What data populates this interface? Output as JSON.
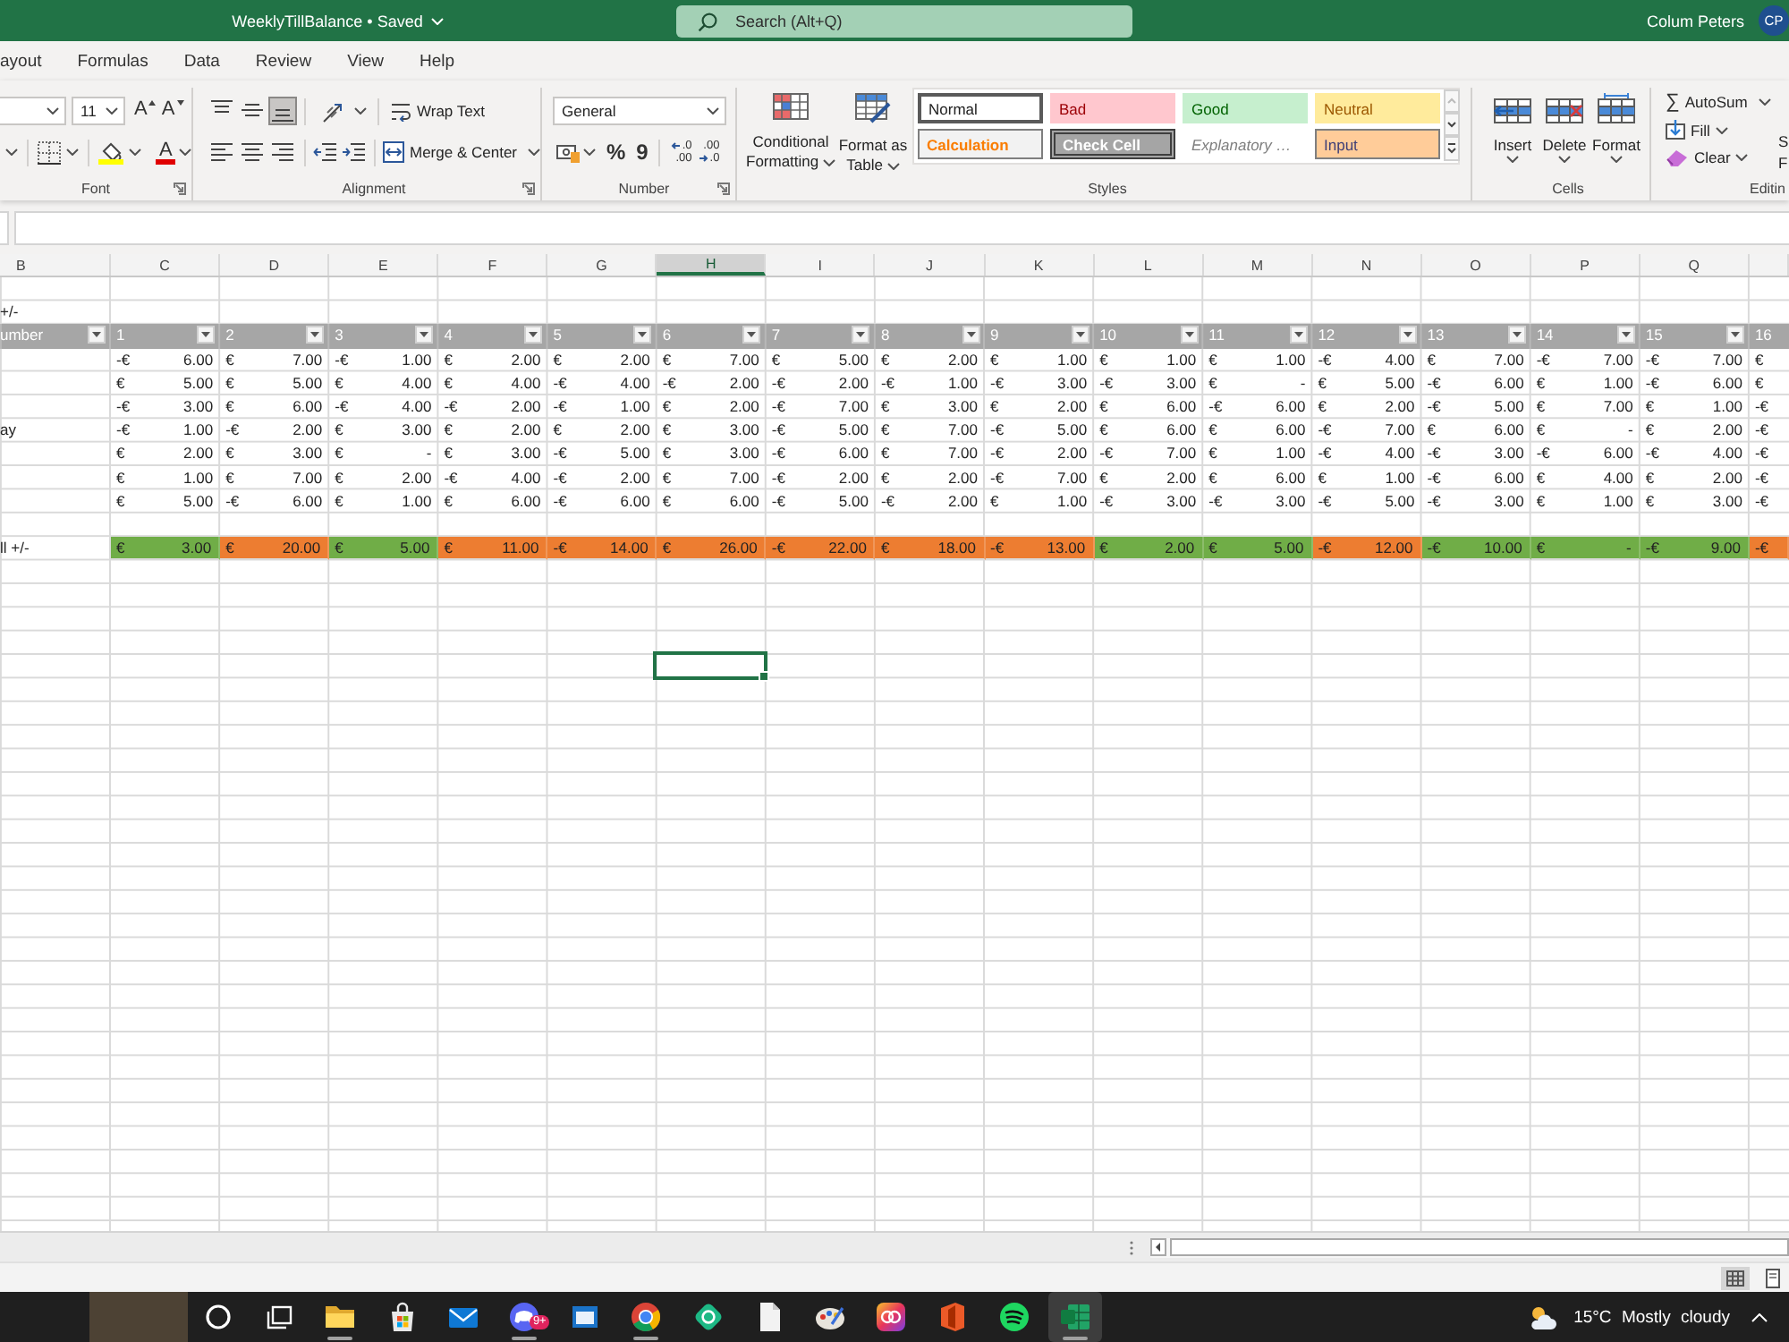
{
  "title_bar": {
    "title": "WeeklyTillBalance • Saved",
    "search_placeholder": "Search (Alt+Q)",
    "user_name": "Colum Peters",
    "avatar_initials": "CP"
  },
  "menu_tabs": [
    {
      "label": "ayout"
    },
    {
      "label": "Formulas"
    },
    {
      "label": "Data"
    },
    {
      "label": "Review"
    },
    {
      "label": "View"
    },
    {
      "label": "Help"
    }
  ],
  "ribbon": {
    "font": {
      "size": "11",
      "grow_glyph": "A",
      "shrink_glyph": "A",
      "color_glyph": "A",
      "label": "Font"
    },
    "alignment": {
      "vertical_align": [
        {
          "kind": "top",
          "selected": false
        },
        {
          "kind": "middle",
          "selected": false
        },
        {
          "kind": "bottom",
          "selected": true
        }
      ],
      "wrap_text": "Wrap Text",
      "merge": "Merge & Center",
      "label": "Alignment"
    },
    "number": {
      "format": "General",
      "percent_glyph": "%",
      "comma_glyph": "9",
      "increase_decimal": [
        ".0",
        ".00"
      ],
      "decrease_decimal": [
        ".00",
        ".0"
      ],
      "label": "Number"
    },
    "styles": {
      "conditional_formatting": [
        "Conditional",
        "Formatting"
      ],
      "format_as_table": [
        "Format as",
        "Table"
      ],
      "cell_styles": [
        {
          "label": "Normal",
          "kind": "normal",
          "selected": true
        },
        {
          "label": "Bad",
          "kind": "bad",
          "selected": false
        },
        {
          "label": "Good",
          "kind": "good",
          "selected": false
        },
        {
          "label": "Neutral",
          "kind": "neutral",
          "selected": false
        },
        {
          "label": "Calculation",
          "kind": "calculation",
          "selected": false
        },
        {
          "label": "Check Cell",
          "kind": "check",
          "selected": false
        },
        {
          "label": "Explanatory …",
          "kind": "explanatory",
          "selected": false
        },
        {
          "label": "Input",
          "kind": "input",
          "selected": false
        }
      ],
      "label": "Styles"
    },
    "cells": {
      "buttons": [
        {
          "kind": "insert",
          "label": "Insert"
        },
        {
          "kind": "delete",
          "label": "Delete"
        },
        {
          "kind": "format",
          "label": "Format"
        }
      ],
      "label": "Cells"
    },
    "editing": {
      "autosum_glyph": "∑",
      "autosum": "AutoSum",
      "fill": "Fill",
      "clear": "Clear",
      "cut_button": [
        "S",
        "F"
      ],
      "label": "Editin"
    }
  },
  "sheet": {
    "columns": [
      {
        "letter": "B",
        "selected": false
      },
      {
        "letter": "C",
        "selected": false
      },
      {
        "letter": "D",
        "selected": false
      },
      {
        "letter": "E",
        "selected": false
      },
      {
        "letter": "F",
        "selected": false
      },
      {
        "letter": "G",
        "selected": false
      },
      {
        "letter": "H",
        "selected": true
      },
      {
        "letter": "I",
        "selected": false
      },
      {
        "letter": "J",
        "selected": false
      },
      {
        "letter": "K",
        "selected": false
      },
      {
        "letter": "L",
        "selected": false
      },
      {
        "letter": "M",
        "selected": false
      },
      {
        "letter": "N",
        "selected": false
      },
      {
        "letter": "O",
        "selected": false
      },
      {
        "letter": "P",
        "selected": false
      },
      {
        "letter": "Q",
        "selected": false
      }
    ],
    "title_row": "+/-",
    "headers": [
      {
        "label": "umber",
        "filter": true
      },
      {
        "label": "1",
        "filter": true
      },
      {
        "label": "2",
        "filter": true
      },
      {
        "label": "3",
        "filter": true
      },
      {
        "label": "4",
        "filter": true
      },
      {
        "label": "5",
        "filter": true
      },
      {
        "label": "6",
        "filter": true
      },
      {
        "label": "7",
        "filter": true
      },
      {
        "label": "8",
        "filter": true
      },
      {
        "label": "9",
        "filter": true
      },
      {
        "label": "10",
        "filter": true
      },
      {
        "label": "11",
        "filter": true
      },
      {
        "label": "12",
        "filter": true
      },
      {
        "label": "13",
        "filter": true
      },
      {
        "label": "14",
        "filter": true
      },
      {
        "label": "15",
        "filter": true
      },
      {
        "label": "16",
        "filter": false
      }
    ],
    "rows": [
      {
        "cells": [
          "",
          {
            "sign": "-€",
            "value": "6.00"
          },
          {
            "sign": "€",
            "value": "7.00"
          },
          {
            "sign": "-€",
            "value": "1.00"
          },
          {
            "sign": "€",
            "value": "2.00"
          },
          {
            "sign": "€",
            "value": "2.00"
          },
          {
            "sign": "€",
            "value": "7.00"
          },
          {
            "sign": "€",
            "value": "5.00"
          },
          {
            "sign": "€",
            "value": "2.00"
          },
          {
            "sign": "€",
            "value": "1.00"
          },
          {
            "sign": "€",
            "value": "1.00"
          },
          {
            "sign": "€",
            "value": "1.00"
          },
          {
            "sign": "-€",
            "value": "4.00"
          },
          {
            "sign": "€",
            "value": "7.00"
          },
          {
            "sign": "-€",
            "value": "7.00"
          },
          {
            "sign": "-€",
            "value": "7.00"
          },
          {
            "sign": "€"
          }
        ]
      },
      {
        "cells": [
          "",
          {
            "sign": "€",
            "value": "5.00"
          },
          {
            "sign": "€",
            "value": "5.00"
          },
          {
            "sign": "€",
            "value": "4.00"
          },
          {
            "sign": "€",
            "value": "4.00"
          },
          {
            "sign": "-€",
            "value": "4.00"
          },
          {
            "sign": "-€",
            "value": "2.00"
          },
          {
            "sign": "-€",
            "value": "2.00"
          },
          {
            "sign": "-€",
            "value": "1.00"
          },
          {
            "sign": "-€",
            "value": "3.00"
          },
          {
            "sign": "-€",
            "value": "3.00"
          },
          {
            "sign": "€",
            "value": "-"
          },
          {
            "sign": "€",
            "value": "5.00"
          },
          {
            "sign": "-€",
            "value": "6.00"
          },
          {
            "sign": "€",
            "value": "1.00"
          },
          {
            "sign": "-€",
            "value": "6.00"
          },
          {
            "sign": "€"
          }
        ]
      },
      {
        "cells": [
          "",
          {
            "sign": "-€",
            "value": "3.00"
          },
          {
            "sign": "€",
            "value": "6.00"
          },
          {
            "sign": "-€",
            "value": "4.00"
          },
          {
            "sign": "-€",
            "value": "2.00"
          },
          {
            "sign": "-€",
            "value": "1.00"
          },
          {
            "sign": "€",
            "value": "2.00"
          },
          {
            "sign": "-€",
            "value": "7.00"
          },
          {
            "sign": "€",
            "value": "3.00"
          },
          {
            "sign": "€",
            "value": "2.00"
          },
          {
            "sign": "€",
            "value": "6.00"
          },
          {
            "sign": "-€",
            "value": "6.00"
          },
          {
            "sign": "€",
            "value": "2.00"
          },
          {
            "sign": "-€",
            "value": "5.00"
          },
          {
            "sign": "€",
            "value": "7.00"
          },
          {
            "sign": "€",
            "value": "1.00"
          },
          {
            "sign": "-€"
          }
        ]
      },
      {
        "cells": [
          "ay",
          {
            "sign": "-€",
            "value": "1.00"
          },
          {
            "sign": "-€",
            "value": "2.00"
          },
          {
            "sign": "€",
            "value": "3.00"
          },
          {
            "sign": "€",
            "value": "2.00"
          },
          {
            "sign": "€",
            "value": "2.00"
          },
          {
            "sign": "€",
            "value": "3.00"
          },
          {
            "sign": "-€",
            "value": "5.00"
          },
          {
            "sign": "€",
            "value": "7.00"
          },
          {
            "sign": "-€",
            "value": "5.00"
          },
          {
            "sign": "€",
            "value": "6.00"
          },
          {
            "sign": "€",
            "value": "6.00"
          },
          {
            "sign": "-€",
            "value": "7.00"
          },
          {
            "sign": "€",
            "value": "6.00"
          },
          {
            "sign": "€",
            "value": "-"
          },
          {
            "sign": "€",
            "value": "2.00"
          },
          {
            "sign": "-€"
          }
        ]
      },
      {
        "cells": [
          "",
          {
            "sign": "€",
            "value": "2.00"
          },
          {
            "sign": "€",
            "value": "3.00"
          },
          {
            "sign": "€",
            "value": "-"
          },
          {
            "sign": "€",
            "value": "3.00"
          },
          {
            "sign": "-€",
            "value": "5.00"
          },
          {
            "sign": "€",
            "value": "3.00"
          },
          {
            "sign": "-€",
            "value": "6.00"
          },
          {
            "sign": "€",
            "value": "7.00"
          },
          {
            "sign": "-€",
            "value": "2.00"
          },
          {
            "sign": "-€",
            "value": "7.00"
          },
          {
            "sign": "€",
            "value": "1.00"
          },
          {
            "sign": "-€",
            "value": "4.00"
          },
          {
            "sign": "-€",
            "value": "3.00"
          },
          {
            "sign": "-€",
            "value": "6.00"
          },
          {
            "sign": "-€",
            "value": "4.00"
          },
          {
            "sign": "-€"
          }
        ]
      },
      {
        "cells": [
          "",
          {
            "sign": "€",
            "value": "1.00"
          },
          {
            "sign": "€",
            "value": "7.00"
          },
          {
            "sign": "€",
            "value": "2.00"
          },
          {
            "sign": "-€",
            "value": "4.00"
          },
          {
            "sign": "-€",
            "value": "2.00"
          },
          {
            "sign": "€",
            "value": "7.00"
          },
          {
            "sign": "-€",
            "value": "2.00"
          },
          {
            "sign": "€",
            "value": "2.00"
          },
          {
            "sign": "-€",
            "value": "7.00"
          },
          {
            "sign": "€",
            "value": "2.00"
          },
          {
            "sign": "€",
            "value": "6.00"
          },
          {
            "sign": "€",
            "value": "1.00"
          },
          {
            "sign": "-€",
            "value": "6.00"
          },
          {
            "sign": "€",
            "value": "4.00"
          },
          {
            "sign": "€",
            "value": "2.00"
          },
          {
            "sign": "-€"
          }
        ]
      },
      {
        "cells": [
          "",
          {
            "sign": "€",
            "value": "5.00"
          },
          {
            "sign": "-€",
            "value": "6.00"
          },
          {
            "sign": "€",
            "value": "1.00"
          },
          {
            "sign": "€",
            "value": "6.00"
          },
          {
            "sign": "-€",
            "value": "6.00"
          },
          {
            "sign": "€",
            "value": "6.00"
          },
          {
            "sign": "-€",
            "value": "5.00"
          },
          {
            "sign": "-€",
            "value": "2.00"
          },
          {
            "sign": "€",
            "value": "1.00"
          },
          {
            "sign": "-€",
            "value": "3.00"
          },
          {
            "sign": "-€",
            "value": "3.00"
          },
          {
            "sign": "-€",
            "value": "5.00"
          },
          {
            "sign": "-€",
            "value": "3.00"
          },
          {
            "sign": "€",
            "value": "1.00"
          },
          {
            "sign": "€",
            "value": "3.00"
          },
          {
            "sign": "-€"
          }
        ]
      }
    ],
    "total_row": {
      "cells": [
        "ll +/-",
        {
          "sign": "€",
          "value": "3.00",
          "color": "#70ad47"
        },
        {
          "sign": "€",
          "value": "20.00",
          "color": "#ed7d31"
        },
        {
          "sign": "€",
          "value": "5.00",
          "color": "#70ad47"
        },
        {
          "sign": "€",
          "value": "11.00",
          "color": "#ed7d31"
        },
        {
          "sign": "-€",
          "value": "14.00",
          "color": "#ed7d31"
        },
        {
          "sign": "€",
          "value": "26.00",
          "color": "#ed7d31"
        },
        {
          "sign": "-€",
          "value": "22.00",
          "color": "#ed7d31"
        },
        {
          "sign": "€",
          "value": "18.00",
          "color": "#ed7d31"
        },
        {
          "sign": "-€",
          "value": "13.00",
          "color": "#ed7d31"
        },
        {
          "sign": "€",
          "value": "2.00",
          "color": "#70ad47"
        },
        {
          "sign": "€",
          "value": "5.00",
          "color": "#70ad47"
        },
        {
          "sign": "-€",
          "value": "12.00",
          "color": "#ed7d31"
        },
        {
          "sign": "-€",
          "value": "10.00",
          "color": "#70ad47"
        },
        {
          "sign": "€",
          "value": "-",
          "color": "#70ad47"
        },
        {
          "sign": "-€",
          "value": "9.00",
          "color": "#70ad47"
        },
        {
          "sign": "-€",
          "color": "#ed7d31"
        }
      ]
    },
    "blank_rows": [
      {
        "selected": false
      },
      {
        "selected": false
      },
      {
        "selected": false
      },
      {
        "selected": false
      },
      {
        "selected": true
      },
      {
        "selected": false
      },
      {
        "selected": false
      },
      {
        "selected": false
      },
      {
        "selected": false
      },
      {
        "selected": false
      },
      {
        "selected": false
      },
      {
        "selected": false
      },
      {
        "selected": false
      },
      {
        "selected": false
      },
      {
        "selected": false
      },
      {
        "selected": false
      },
      {
        "selected": false
      },
      {
        "selected": false
      },
      {
        "selected": false
      },
      {
        "selected": false
      },
      {
        "selected": false
      },
      {
        "selected": false
      },
      {
        "selected": false
      },
      {
        "selected": false
      },
      {
        "selected": false
      },
      {
        "selected": false
      },
      {
        "selected": false
      },
      {
        "selected": false
      },
      {
        "selected": false
      }
    ]
  },
  "status_bar": {
    "views": [
      {
        "kind": "normal",
        "selected": true
      },
      {
        "kind": "page-layout",
        "selected": false
      }
    ]
  },
  "taskbar": {
    "items": [
      {
        "kind": "search",
        "running": false,
        "selected": false
      },
      {
        "kind": "task-view",
        "running": false,
        "selected": false
      },
      {
        "kind": "folder",
        "running": true,
        "selected": false
      },
      {
        "kind": "store",
        "running": false,
        "selected": false
      },
      {
        "kind": "mail",
        "running": false,
        "selected": false
      },
      {
        "kind": "chat",
        "running": true,
        "selected": false,
        "badge": "9+"
      },
      {
        "kind": "window",
        "running": false,
        "selected": false
      },
      {
        "kind": "browser",
        "running": true,
        "selected": false
      },
      {
        "kind": "sync",
        "running": false,
        "selected": false
      },
      {
        "kind": "document",
        "running": false,
        "selected": false
      },
      {
        "kind": "palette",
        "running": false,
        "selected": false
      },
      {
        "kind": "gradient",
        "running": false,
        "selected": false
      },
      {
        "kind": "office",
        "running": false,
        "selected": false
      },
      {
        "kind": "music",
        "running": false,
        "selected": false
      },
      {
        "kind": "spreadsheet",
        "running": true,
        "selected": true
      }
    ],
    "weather": {
      "temperature": "15°C",
      "condition": "Mostly cloudy"
    }
  }
}
